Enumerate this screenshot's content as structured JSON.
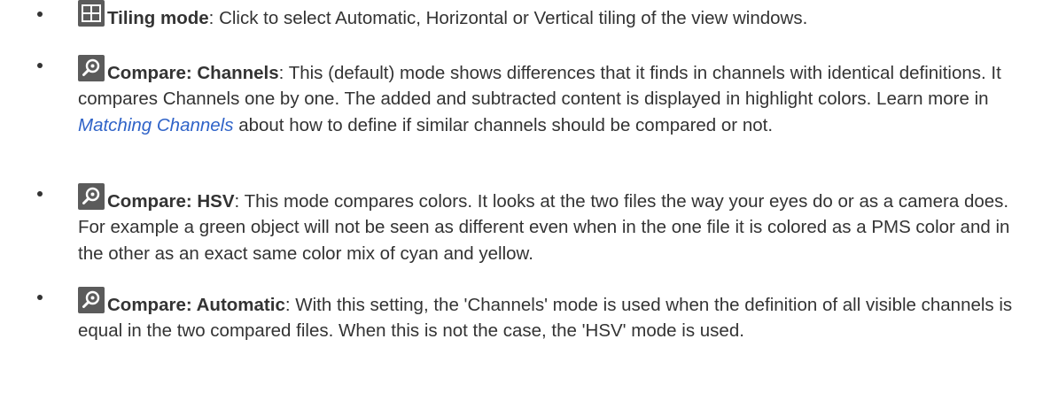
{
  "items": [
    {
      "icon": "tiling-grid-icon",
      "term": "Tiling mode",
      "sep": ": ",
      "text": "Click to select Automatic, Horizontal or Vertical tiling of the view windows."
    },
    {
      "icon": "compare-magnifier-icon",
      "term": "Compare: Channels",
      "sep": ": ",
      "text_before_link": "This (default) mode shows differences that it finds in channels with identical definitions. It compares Channels one by one. The added and subtracted content is displayed in highlight colors. Learn more in ",
      "link": "Matching Channels",
      "text_after_link": " about how to define if similar channels should be compared or not."
    },
    {
      "icon": "compare-magnifier-icon",
      "term": "Compare: HSV",
      "sep": ": ",
      "text": "This mode compares colors. It looks at the two files the way your eyes do or as a camera does. For example a green object will not be seen as different even when in the one file it is colored as a PMS color and in the other as an exact same color mix of cyan and yellow."
    },
    {
      "icon": "compare-magnifier-icon",
      "term": "Compare: Automatic",
      "sep": ": ",
      "text": "With this setting, the 'Channels' mode is used when the definition of all visible channels is equal in the two compared files. When this is not the case, the 'HSV' mode is used."
    }
  ]
}
